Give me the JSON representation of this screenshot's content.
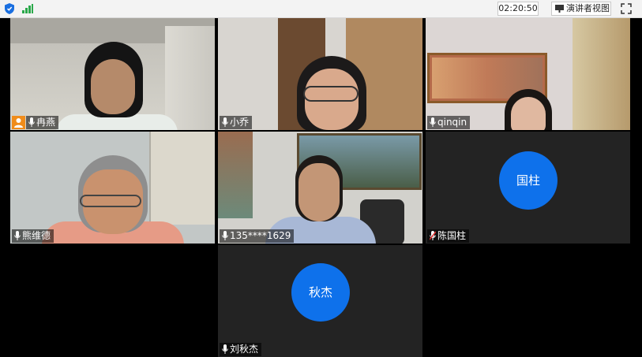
{
  "topbar": {
    "timer": "02:20:50",
    "presenter_view_label": "演讲者视图"
  },
  "participants": [
    {
      "name": "冉燕",
      "muted": false,
      "host": true,
      "video": true
    },
    {
      "name": "小乔",
      "muted": false,
      "host": false,
      "video": true
    },
    {
      "name": "qinqin",
      "muted": false,
      "host": false,
      "video": true
    },
    {
      "name": "熊维德",
      "muted": false,
      "host": false,
      "video": true
    },
    {
      "name": "135****1629",
      "muted": false,
      "host": false,
      "video": true,
      "speaking": true
    },
    {
      "name": "陈国柱",
      "muted": true,
      "host": false,
      "video": false,
      "avatar_text": "国柱"
    },
    {
      "name": "刘秋杰",
      "muted": false,
      "host": false,
      "video": false,
      "avatar_text": "秋杰"
    }
  ],
  "colors": {
    "avatar_bg": "#0e71eb",
    "active_speaker_border": "#3bb54a",
    "host_badge": "#f08c1a",
    "muted_mic": "#e03030"
  }
}
